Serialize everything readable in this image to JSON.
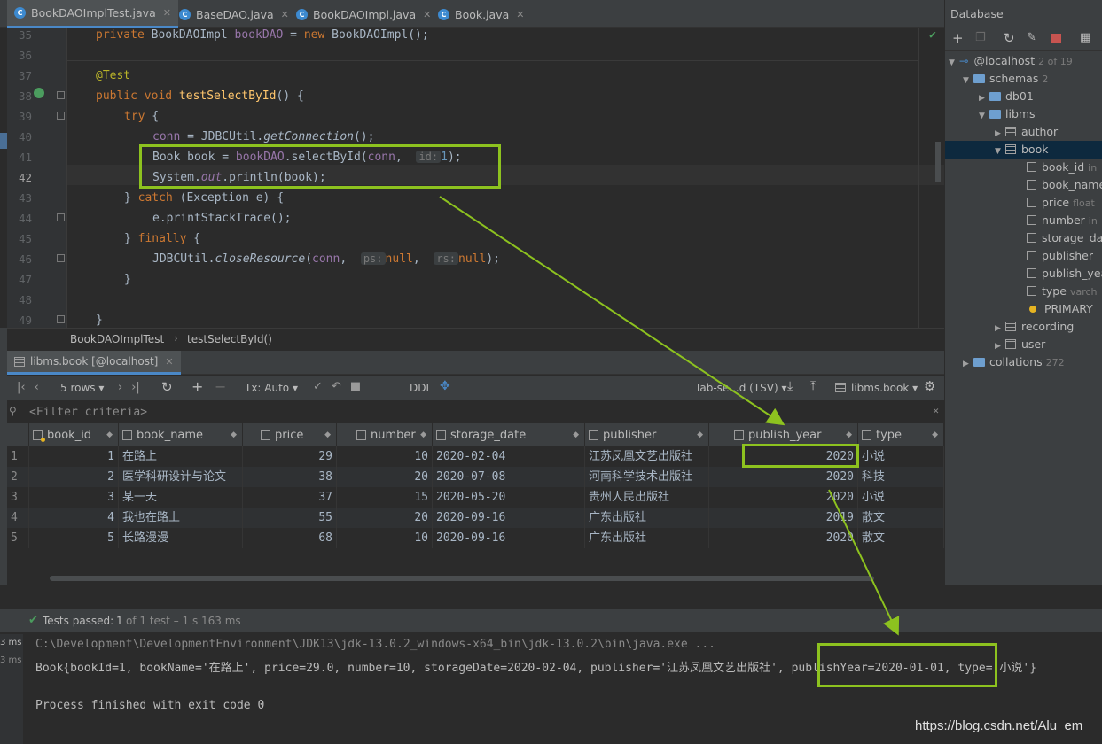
{
  "tabs": [
    {
      "label": "BookDAOImplTest.java",
      "active": true
    },
    {
      "label": "BaseDAO.java",
      "active": false
    },
    {
      "label": "BookDAOImpl.java",
      "active": false
    },
    {
      "label": "Book.java",
      "active": false
    }
  ],
  "editor": {
    "line_numbers": [
      "35",
      "36",
      "37",
      "38",
      "39",
      "40",
      "41",
      "42",
      "43",
      "44",
      "45",
      "46",
      "47",
      "48",
      "49"
    ],
    "code": {
      "l35a": "private ",
      "l35b": "BookDAOImpl ",
      "l35c": "bookDAO",
      "l35d": " = ",
      "l35e": "new ",
      "l35f": "BookDAOImpl();",
      "l37": "@Test",
      "l38a": "public void ",
      "l38b": "testSelectById",
      "l38c": "() {",
      "l39a": "try",
      "l39b": " {",
      "l40a": "conn",
      "l40b": " = JDBCUtil.",
      "l40c": "getConnection",
      "l40d": "();",
      "l41a": "Book book = ",
      "l41b": "bookDAO",
      "l41c": ".selectById(",
      "l41d": "conn",
      "l41e": ", ",
      "l41hint": "id:",
      "l41f": "1",
      "l41g": ");",
      "l42a": "System.",
      "l42b": "out",
      "l42c": ".println(book);",
      "l43a": "} ",
      "l43b": "catch",
      "l43c": " (Exception e) {",
      "l44": "e.printStackTrace();",
      "l45a": "} ",
      "l45b": "finally",
      "l45c": " {",
      "l46a": "JDBCUtil.",
      "l46b": "closeResource",
      "l46c": "(",
      "l46d": "conn",
      "l46e": ", ",
      "l46hint1": "ps:",
      "l46f": "null",
      "l46g": ", ",
      "l46hint2": "rs:",
      "l46h": "null",
      "l46i": ");",
      "l47": "}",
      "l49": "}"
    }
  },
  "breadcrumb": {
    "class": "BookDAOImplTest",
    "method": "testSelectById()"
  },
  "results": {
    "tab_label": "libms.book [@localhost]",
    "toolbar": {
      "rows": "5 rows",
      "tx": "Tx: Auto",
      "ddl": "DDL",
      "format": "Tab-se...d (TSV)",
      "target": "libms.book"
    },
    "filter_placeholder": "<Filter criteria>",
    "columns": [
      "book_id",
      "book_name",
      "price",
      "number",
      "storage_date",
      "publisher",
      "publish_year",
      "type"
    ],
    "rows": [
      [
        "1",
        "1",
        "在路上",
        "29",
        "10",
        "2020-02-04",
        "江苏凤凰文艺出版社",
        "2020",
        "小说"
      ],
      [
        "2",
        "2",
        "医学科研设计与论文",
        "38",
        "20",
        "2020-07-08",
        "河南科学技术出版社",
        "2020",
        "科技"
      ],
      [
        "3",
        "3",
        "某一天",
        "37",
        "15",
        "2020-05-20",
        "贵州人民出版社",
        "2020",
        "小说"
      ],
      [
        "4",
        "4",
        "我也在路上",
        "55",
        "20",
        "2020-09-16",
        "广东出版社",
        "2019",
        "散文"
      ],
      [
        "5",
        "5",
        "长路漫漫",
        "68",
        "10",
        "2020-09-16",
        "广东出版社",
        "2020",
        "散文"
      ]
    ]
  },
  "test": {
    "status": "Tests passed:",
    "count": "1",
    "detail": "of 1 test – 1 s 163 ms",
    "gutter_ms1": "3 ms",
    "gutter_ms2": "3 ms",
    "console": {
      "line1": "C:\\Development\\DevelopmentEnvironment\\JDK13\\jdk-13.0.2_windows-x64_bin\\jdk-13.0.2\\bin\\java.exe ...",
      "line2a": "Book{bookId=1, bookName='在路上', price=29.0, number=10, storageDate=2020-02-04, publisher='江苏凤凰文艺出版社', ",
      "line2b": "publishYear=2020-01-01",
      "line2c": ", type='小说'}",
      "line3": "Process finished with exit code 0"
    }
  },
  "database": {
    "title": "Database",
    "tree": [
      {
        "label": "@localhost",
        "meta": "2 of 19"
      },
      {
        "label": "schemas",
        "meta": "2"
      },
      {
        "label": "db01",
        "meta": ""
      },
      {
        "label": "libms",
        "meta": ""
      },
      {
        "label": "author",
        "meta": ""
      },
      {
        "label": "book",
        "meta": ""
      },
      {
        "label": "book_id",
        "meta": "in"
      },
      {
        "label": "book_name",
        "meta": ""
      },
      {
        "label": "price",
        "meta": "float"
      },
      {
        "label": "number",
        "meta": "in"
      },
      {
        "label": "storage_da",
        "meta": ""
      },
      {
        "label": "publisher",
        "meta": ""
      },
      {
        "label": "publish_yea",
        "meta": ""
      },
      {
        "label": "type",
        "meta": "varch"
      },
      {
        "label": "PRIMARY",
        "meta": ""
      },
      {
        "label": "recording",
        "meta": ""
      },
      {
        "label": "user",
        "meta": ""
      },
      {
        "label": "collations",
        "meta": "272"
      }
    ]
  },
  "watermark": "https://blog.csdn.net/Alu_em",
  "colors": {
    "highlight": "#8dc21f",
    "accent": "#4a88c7"
  }
}
